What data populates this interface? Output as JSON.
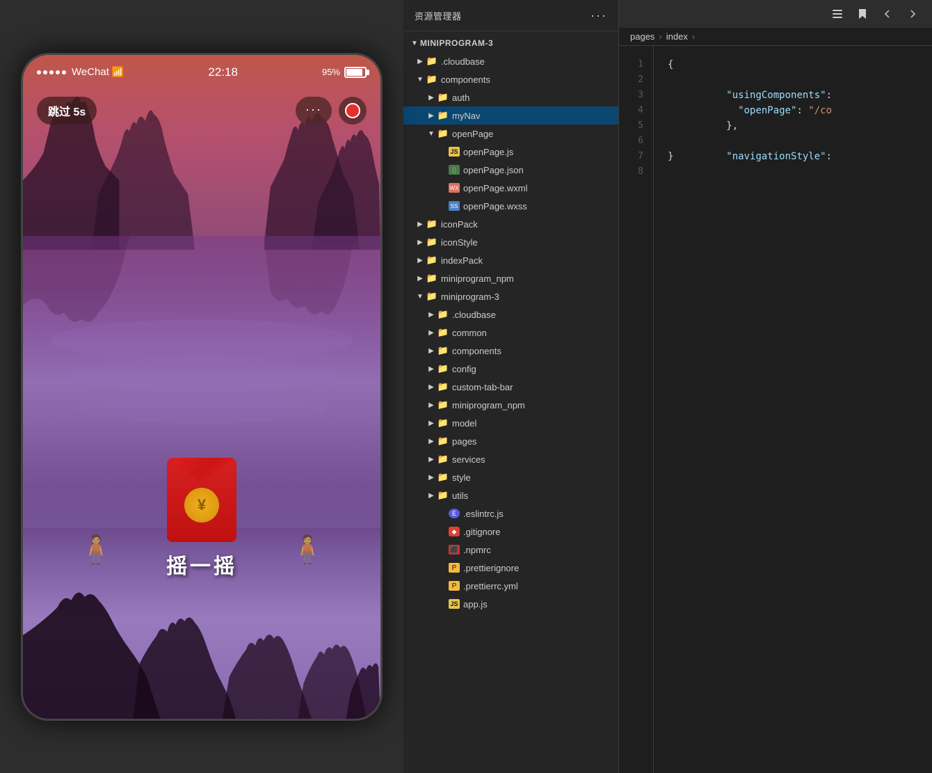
{
  "phone": {
    "signal_label": "●●●●●",
    "carrier": "WeChat",
    "wifi": "📶",
    "time": "22:18",
    "battery_pct": "95%",
    "skip_label": "跳过 5s",
    "dots_label": "···",
    "shake_text": "摇一摇"
  },
  "explorer": {
    "title": "资源管理器",
    "menu_dots": "···",
    "root": {
      "label": "MINIPROGRAM-3",
      "children": [
        {
          "id": "cloudbase1",
          "label": ".cloudbase",
          "type": "folder",
          "indent": 1,
          "open": false
        },
        {
          "id": "components1",
          "label": "components",
          "type": "folder-special",
          "indent": 1,
          "open": true
        },
        {
          "id": "auth",
          "label": "auth",
          "type": "folder-yellow",
          "indent": 2,
          "open": false
        },
        {
          "id": "myNav",
          "label": "myNav",
          "type": "folder-yellow",
          "indent": 2,
          "open": false,
          "selected": true
        },
        {
          "id": "openPage",
          "label": "openPage",
          "type": "folder-yellow",
          "indent": 2,
          "open": true
        },
        {
          "id": "openPageJs",
          "label": "openPage.js",
          "type": "js",
          "indent": 3
        },
        {
          "id": "openPageJson",
          "label": "openPage.json",
          "type": "json",
          "indent": 3
        },
        {
          "id": "openPageWxml",
          "label": "openPage.wxml",
          "type": "wxml",
          "indent": 3
        },
        {
          "id": "openPageWxss",
          "label": "openPage.wxss",
          "type": "wxss",
          "indent": 3
        },
        {
          "id": "iconPack",
          "label": "iconPack",
          "type": "folder",
          "indent": 1,
          "open": false
        },
        {
          "id": "iconStyle",
          "label": "iconStyle",
          "type": "folder",
          "indent": 1,
          "open": false
        },
        {
          "id": "indexPack",
          "label": "indexPack",
          "type": "folder",
          "indent": 1,
          "open": false
        },
        {
          "id": "miniprogram_npm1",
          "label": "miniprogram_npm",
          "type": "folder",
          "indent": 1,
          "open": false
        },
        {
          "id": "miniprogram3",
          "label": "miniprogram-3",
          "type": "folder",
          "indent": 1,
          "open": true
        },
        {
          "id": "cloudbase2",
          "label": ".cloudbase",
          "type": "folder",
          "indent": 2,
          "open": false
        },
        {
          "id": "common",
          "label": "common",
          "type": "folder",
          "indent": 2,
          "open": false
        },
        {
          "id": "components2",
          "label": "components",
          "type": "folder-special",
          "indent": 2,
          "open": false
        },
        {
          "id": "config",
          "label": "config",
          "type": "folder-blue",
          "indent": 2,
          "open": false
        },
        {
          "id": "customTabBar",
          "label": "custom-tab-bar",
          "type": "folder",
          "indent": 2,
          "open": false
        },
        {
          "id": "miniprogram_npm2",
          "label": "miniprogram_npm",
          "type": "folder",
          "indent": 2,
          "open": false
        },
        {
          "id": "model",
          "label": "model",
          "type": "folder-pink",
          "indent": 2,
          "open": false
        },
        {
          "id": "pages",
          "label": "pages",
          "type": "folder-pink",
          "indent": 2,
          "open": false
        },
        {
          "id": "services",
          "label": "services",
          "type": "folder-yellow",
          "indent": 2,
          "open": false
        },
        {
          "id": "style",
          "label": "style",
          "type": "folder-blue",
          "indent": 2,
          "open": false
        },
        {
          "id": "utils",
          "label": "utils",
          "type": "folder-green",
          "indent": 2,
          "open": false
        },
        {
          "id": "eslintrc",
          "label": ".eslintrc.js",
          "type": "eslint",
          "indent": 2
        },
        {
          "id": "gitignore",
          "label": ".gitignore",
          "type": "git",
          "indent": 2
        },
        {
          "id": "npmrc",
          "label": ".npmrc",
          "type": "npm",
          "indent": 2
        },
        {
          "id": "prettierignore",
          "label": ".prettierignore",
          "type": "prettier",
          "indent": 2
        },
        {
          "id": "prettierrc",
          "label": ".prettierrc.yml",
          "type": "prettier",
          "indent": 2
        },
        {
          "id": "appjs",
          "label": "app.js",
          "type": "js",
          "indent": 2
        }
      ]
    }
  },
  "editor": {
    "tab_label": "pages > index >",
    "breadcrumbs": [
      "pages",
      "index"
    ],
    "lines": [
      {
        "num": 1,
        "text": "{",
        "tokens": [
          {
            "t": "brace",
            "v": "{"
          }
        ]
      },
      {
        "num": 2,
        "text": "  \"usingComponents\":",
        "tokens": [
          {
            "t": "key",
            "v": "  \"usingComponents\":"
          }
        ]
      },
      {
        "num": 3,
        "text": "    \"openPage\": \"/co",
        "tokens": [
          {
            "t": "key",
            "v": "    \"openPage\": "
          },
          {
            "t": "str",
            "v": "\"/co"
          }
        ]
      },
      {
        "num": 4,
        "text": "  },",
        "tokens": [
          {
            "t": "brace",
            "v": "  },"
          }
        ]
      },
      {
        "num": 5,
        "text": "",
        "tokens": []
      },
      {
        "num": 6,
        "text": "  \"navigationStyle\":",
        "tokens": [
          {
            "t": "key",
            "v": "  \"navigationStyle\":"
          }
        ]
      },
      {
        "num": 7,
        "text": "}",
        "tokens": [
          {
            "t": "brace",
            "v": "}"
          }
        ]
      },
      {
        "num": 8,
        "text": "",
        "tokens": []
      }
    ]
  }
}
